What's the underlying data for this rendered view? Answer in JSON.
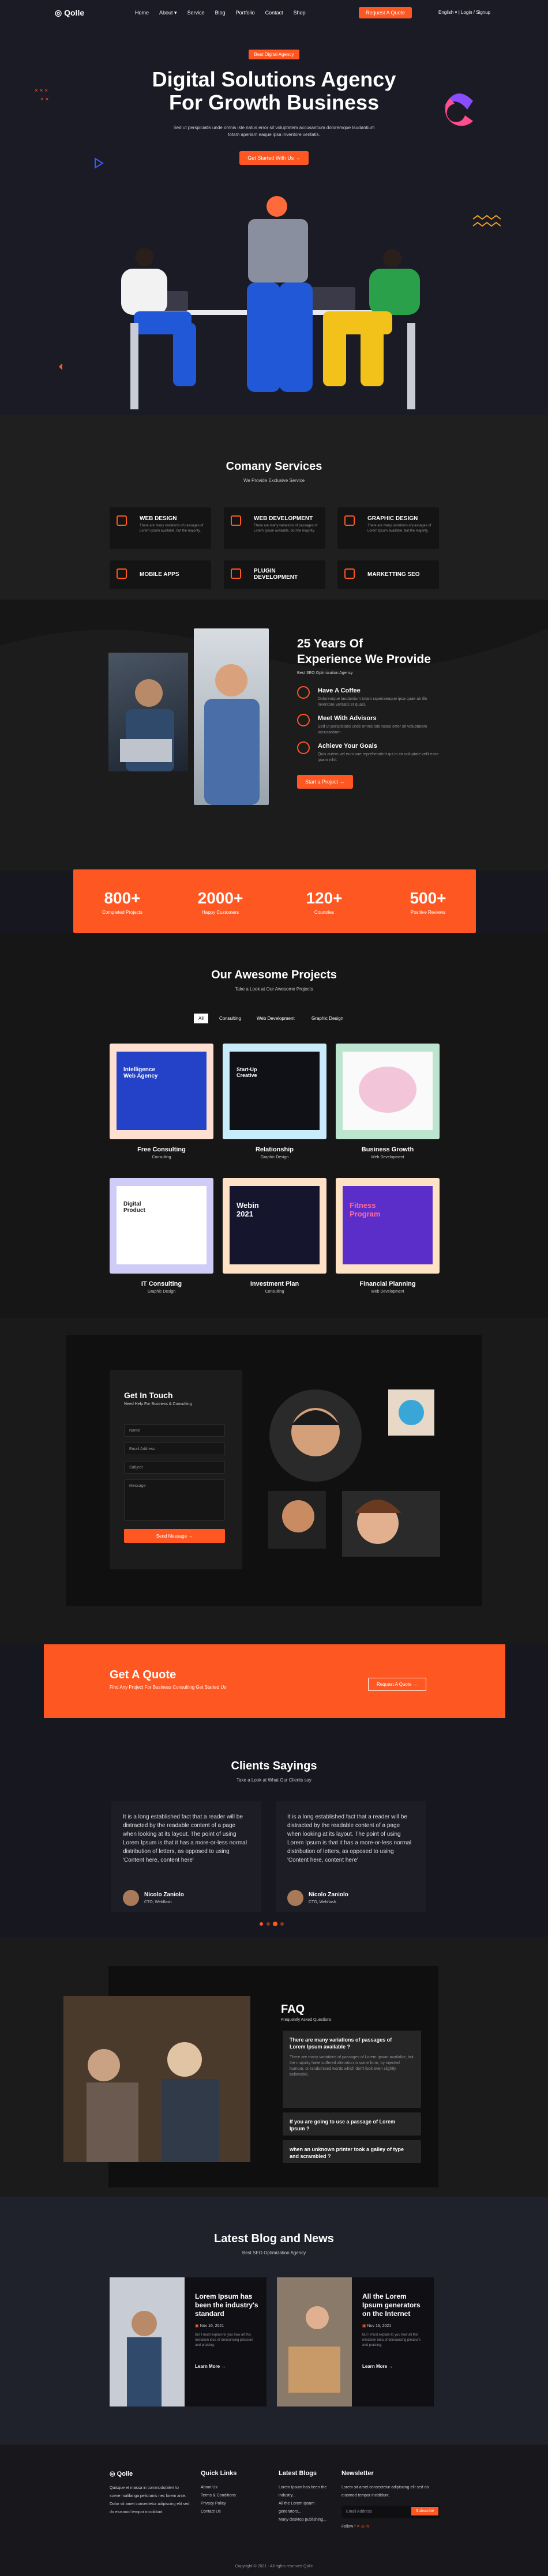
{
  "nav": {
    "logo": "Qolle",
    "links": [
      "Home",
      "About ▾",
      "Service",
      "Blog",
      "Portfolio",
      "Contact",
      "Shop"
    ],
    "request": "Request A Quote",
    "lang": "English ▾  |  Login / Signup"
  },
  "hero": {
    "badge": "Best Digital Agency",
    "title_1": "Digital Solutions Agency",
    "title_2": "For Growth Business",
    "sub": "Sed ut perspiciatis unde omnis iste natus error sit voluptatem accusantium doloremque laudantium totam aperiam eaque ipsa inventore veritatis.",
    "cta": "Get Started With Us  →"
  },
  "services": {
    "title": "Comany Services",
    "sub": "We Provide Exclusive Service",
    "items": [
      {
        "t": "WEB DESIGN",
        "d": "There are many variations of passages of Lorem Ipsum available, but the majority."
      },
      {
        "t": "WEB DEVELOPMENT",
        "d": "There are many variations of passages of Lorem Ipsum available, but the majority."
      },
      {
        "t": "GRAPHIC DESIGN",
        "d": "There are many variations of passages of Lorem Ipsum available, but the majority."
      },
      {
        "t": "MOBILE APPS",
        "d": ""
      },
      {
        "t": "PLUGIN DEVELOPMENT",
        "d": ""
      },
      {
        "t": "MARKETTING SEO",
        "d": ""
      }
    ]
  },
  "experience": {
    "title_1": "25 Years Of",
    "title_2": "Experience We Provide",
    "sub": "Best SEO Optimization Agency",
    "features": [
      {
        "t": "Have A Coffee",
        "d": "Doloremque laudantium totam raperiaeaque ipsa quae ab illo inventore veritatis et quasi."
      },
      {
        "t": "Meet With Advisors",
        "d": "Sed ut perspiciatis unde omnis iste natus error sit voluptatem accusantium."
      },
      {
        "t": "Achieve Your Goals",
        "d": "Quis autem vel eum iure reprehenderit qui in ea voluptate velit esse quam nihil."
      }
    ],
    "cta": "Start a Project  →"
  },
  "stats": [
    {
      "n": "800+",
      "l": "Completed Projects"
    },
    {
      "n": "2000+",
      "l": "Happy Customers"
    },
    {
      "n": "120+",
      "l": "Countries"
    },
    {
      "n": "500+",
      "l": "Positive Reviews"
    }
  ],
  "projects": {
    "title": "Our Awesome Projects",
    "sub": "Take a Look at Our Awesome Projects",
    "tabs": [
      "All",
      "Consulting",
      "Web Development",
      "Graphic Design"
    ],
    "items": [
      {
        "t": "Free Consulting",
        "c": "Consulting",
        "inner": "Intelligence Web Agency"
      },
      {
        "t": "Relationship",
        "c": "Graphic Design",
        "inner": "Start-Up Creative"
      },
      {
        "t": "Business Growth",
        "c": "Web Development",
        "inner": ""
      },
      {
        "t": "IT Consulting",
        "c": "Graphic Design",
        "inner": "Digital Product"
      },
      {
        "t": "Investment Plan",
        "c": "Consulting",
        "inner": "Webin 2021"
      },
      {
        "t": "Financial Planning",
        "c": "Web Development",
        "inner": "Fitness Program"
      }
    ]
  },
  "contact": {
    "title": "Get In Touch",
    "sub": "Need Help For Business & Consulting",
    "fields": [
      "Name",
      "Email Address",
      "Subject",
      "Message"
    ],
    "send": "Send Message  →"
  },
  "quote": {
    "title": "Get A Quote",
    "sub": "Find Any Project For Business Consulting Get Started Us",
    "btn": "Request A Quote  →"
  },
  "clients": {
    "title": "Clients Sayings",
    "sub": "Take a Look at What Our Clients say",
    "items": [
      {
        "text": "It is a long established fact that a reader will be distracted by the readable content of a page when looking at its layout. The point of using Lorem Ipsum is that it has a more-or-less normal distribution of letters, as opposed to using 'Content here, content here'",
        "name": "Nicolo Zaniolo",
        "role": "CTO, Webflash"
      },
      {
        "text": "It is a long established fact that a reader will be distracted by the readable content of a page when looking at its layout. The point of using Lorem Ipsum is that it has a more-or-less normal distribution of letters, as opposed to using 'Content here, content here'",
        "name": "Nicolo Zaniolo",
        "role": "CTO, Webflash"
      }
    ]
  },
  "faq": {
    "title": "FAQ",
    "sub": "Frequently Asked Questions",
    "items": [
      {
        "q": "There are many variations of passages of Lorem Ipsum available ?",
        "a": "There are many variations of passages of Lorem Ipsum available, but the majority have suffered alteration in some form, by injected humour, or randomised words which don't look even slightly believable."
      },
      {
        "q": "If you are going to use a passage of Lorem Ipsum ?",
        "a": ""
      },
      {
        "q": "when an unknown printer took a galley of type and scrambled ?",
        "a": ""
      }
    ]
  },
  "blog": {
    "title": "Latest Blog and News",
    "sub": "Best SEO Optimization Agency",
    "posts": [
      {
        "t": "Lorem Ipsum has been the industry's standard",
        "date": "Nov 16, 2021",
        "d": "But I must explain to you how all this mistaken idea of denouncing pleasure and praising.",
        "more": "Learn More  →"
      },
      {
        "t": "All the Lorem Ipsum generators on the Internet",
        "date": "Nov 16, 2021",
        "d": "But I must explain to you how all this mistaken idea of denouncing pleasure and praising.",
        "more": "Learn More  →"
      }
    ]
  },
  "footer": {
    "logo": "Qolle",
    "about": "Quisque et massa in commodo/alert to scene malifanga pelicranis nec lorem ante. Dolor sit amet consectetur adipiscing elit sed do eiusmod tempor incididunt.",
    "quick_title": "Quick Links",
    "quick": [
      "About Us",
      "Terms & Conditions",
      "Privacy Policy",
      "Contact Us"
    ],
    "blogs_title": "Latest Blogs",
    "blogs": [
      "Lorem Ipsum has been the industry...",
      "All the Lorem Ipsum generators...",
      "Many desktop publishing..."
    ],
    "news_title": "Newsletter",
    "news_sub": "Lorem sit amet consectetur adipiscing elit sed do eiusmod tempor incididunt.",
    "email": "Email Address",
    "subscribe": "Subscribe",
    "follow": "Follow",
    "copyright": "Copyright © 2021 - All rights reserved Qolle"
  },
  "colors": {
    "accent": "#ff5722",
    "bg": "#17181f"
  }
}
